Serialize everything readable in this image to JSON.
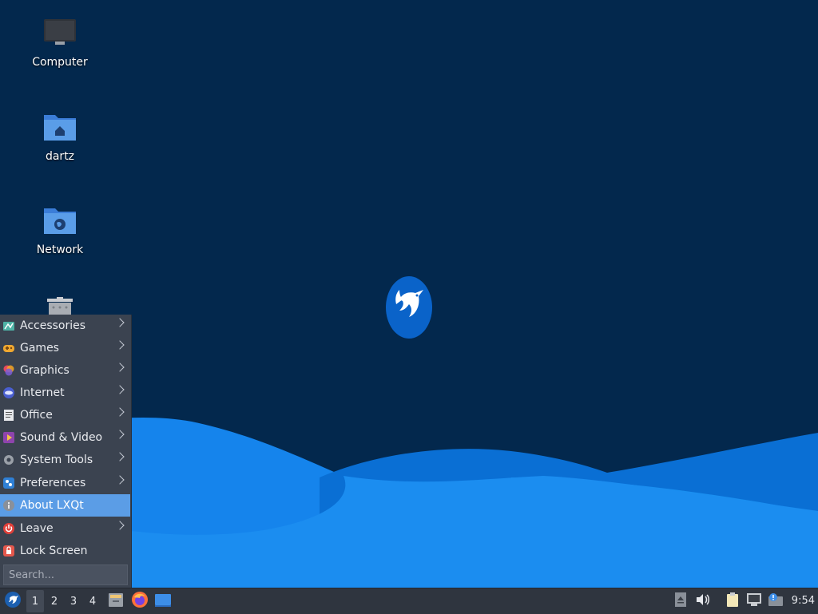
{
  "desktop": {
    "icons": [
      {
        "label": "Computer",
        "icon": "computer-icon"
      },
      {
        "label": "dartz",
        "icon": "home-folder-icon"
      },
      {
        "label": "Network",
        "icon": "network-folder-icon"
      },
      {
        "label": "",
        "icon": "trash-icon"
      }
    ],
    "logo": "lxqt-bird-logo"
  },
  "menu": {
    "items": [
      {
        "label": "Accessories",
        "icon": "accessories-icon",
        "submenu": true
      },
      {
        "label": "Games",
        "icon": "games-icon",
        "submenu": true
      },
      {
        "label": "Graphics",
        "icon": "graphics-icon",
        "submenu": true
      },
      {
        "label": "Internet",
        "icon": "internet-icon",
        "submenu": true
      },
      {
        "label": "Office",
        "icon": "office-icon",
        "submenu": true
      },
      {
        "label": "Sound & Video",
        "icon": "sound-video-icon",
        "submenu": true
      },
      {
        "label": "System Tools",
        "icon": "system-tools-icon",
        "submenu": true
      },
      {
        "label": "Preferences",
        "icon": "preferences-icon",
        "submenu": true
      },
      {
        "label": "About LXQt",
        "icon": "about-icon",
        "submenu": false,
        "highlighted": true
      },
      {
        "label": "Leave",
        "icon": "leave-icon",
        "submenu": true
      },
      {
        "label": "Lock Screen",
        "icon": "lock-icon",
        "submenu": false
      }
    ],
    "search_placeholder": "Search..."
  },
  "taskbar": {
    "workspaces": [
      "1",
      "2",
      "3",
      "4"
    ],
    "current_workspace": "1",
    "launchers": [
      "file-manager-icon",
      "firefox-icon",
      "show-desktop-icon"
    ],
    "tray": [
      "eject-icon",
      "volume-icon",
      "clipboard-icon",
      "network-icon",
      "update-notifier-icon"
    ],
    "clock": "9:54"
  },
  "colors": {
    "desktop_bg": "#03284d",
    "wave_light": "#1a8cf0",
    "wave_dark": "#0a6bd0",
    "menu_bg": "#3b4350",
    "menu_highlight": "#5b9de6",
    "taskbar_bg": "#2f353f"
  }
}
